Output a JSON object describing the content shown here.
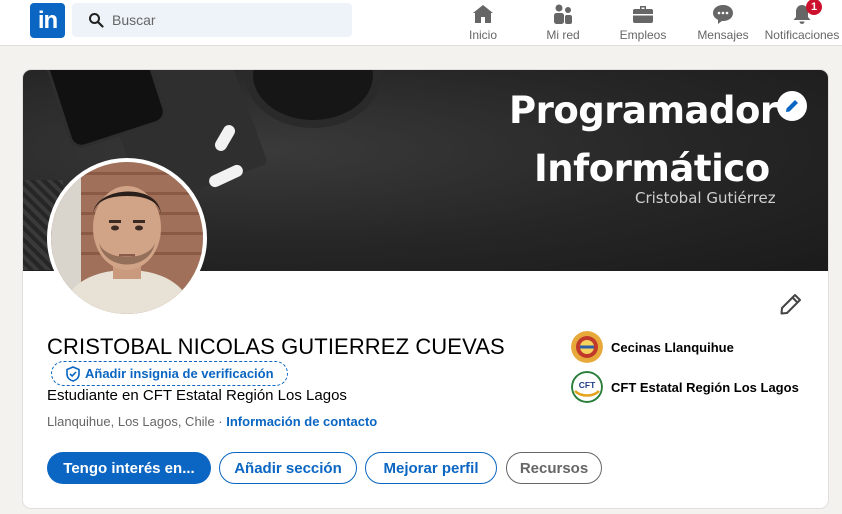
{
  "colors": {
    "brand": "#0a66c2",
    "badge": "#cb112d",
    "page_bg": "#f4f2ee"
  },
  "nav": {
    "logo_text": "in",
    "search": {
      "placeholder": "Buscar",
      "icon": "search-icon"
    },
    "items": [
      {
        "label": "Inicio",
        "icon": "home-icon"
      },
      {
        "label": "Mi red",
        "icon": "network-icon"
      },
      {
        "label": "Empleos",
        "icon": "briefcase-icon"
      },
      {
        "label": "Mensajes",
        "icon": "message-icon"
      },
      {
        "label": "Notificaciones",
        "icon": "bell-icon",
        "badge": "1"
      }
    ]
  },
  "banner": {
    "title_line1": "Programador",
    "title_line2": "Informático",
    "subtitle": "Cristobal Gutiérrez"
  },
  "profile": {
    "name": "CRISTOBAL NICOLAS GUTIERREZ CUEVAS",
    "verify_label": "Añadir insignia de verificación",
    "headline": "Estudiante en CFT Estatal Región Los Lagos",
    "location": "Llanquihue, Los Lagos, Chile",
    "separator": " · ",
    "contact_label": "Información de contacto",
    "organizations": [
      {
        "name": "Cecinas Llanquihue"
      },
      {
        "name": "CFT Estatal Región Los Lagos",
        "logo_text": "CFT"
      }
    ]
  },
  "actions": {
    "open_to": "Tengo interés en...",
    "add_section": "Añadir sección",
    "improve_profile": "Mejorar perfil",
    "resources": "Recursos"
  }
}
